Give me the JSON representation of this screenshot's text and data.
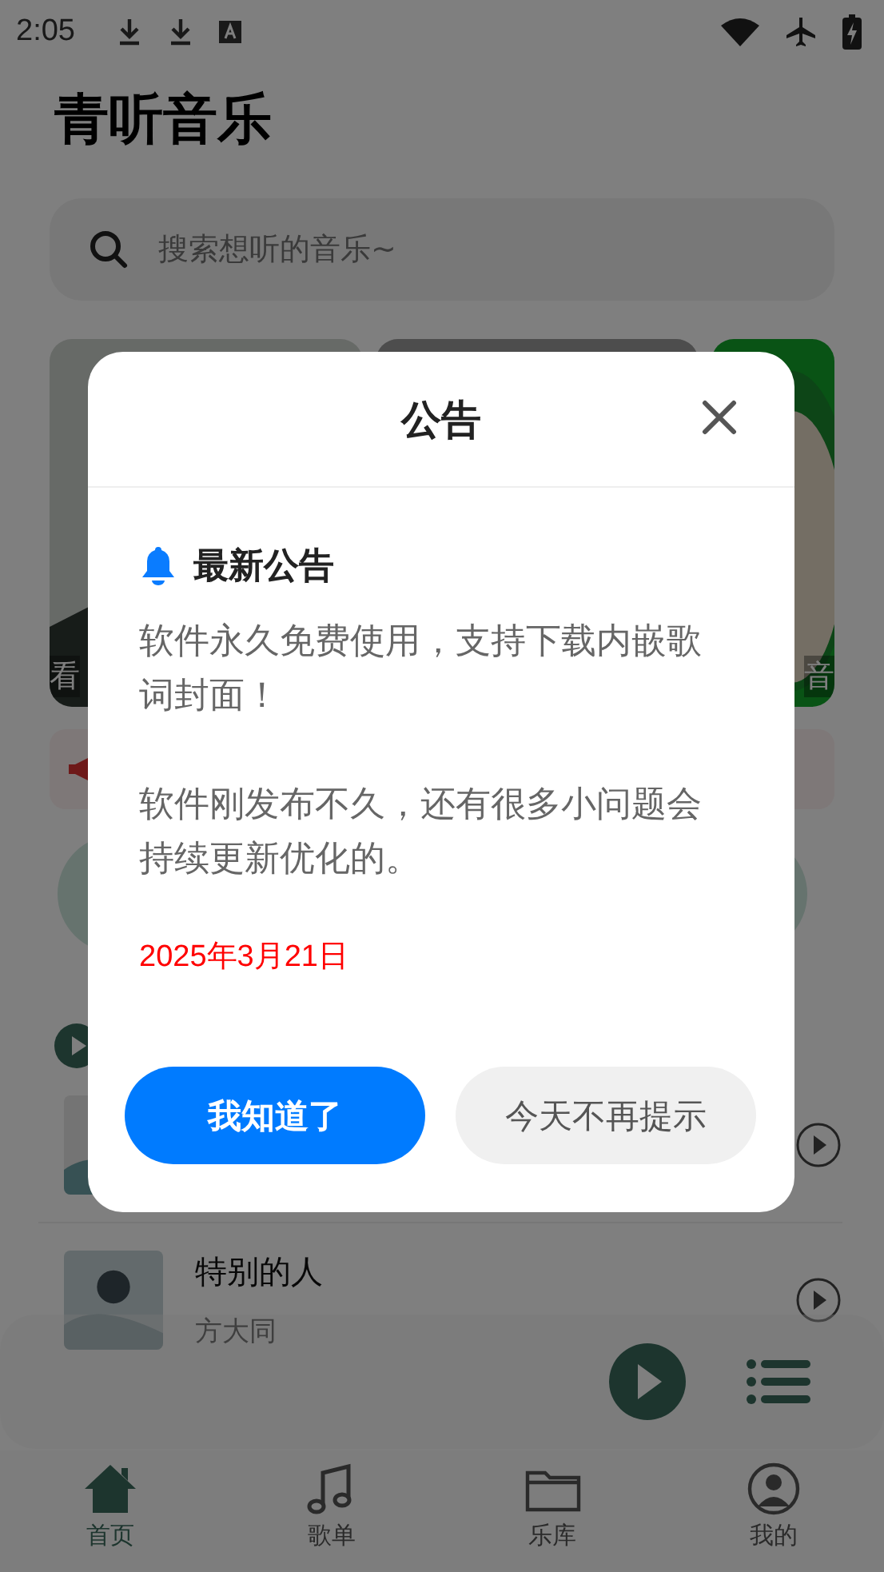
{
  "status_bar": {
    "time": "2:05"
  },
  "app": {
    "title": "青听音乐",
    "search": {
      "placeholder": "搜索想听的音乐~"
    },
    "banners": [
      {
        "kind": "picture",
        "caption": "看"
      },
      {
        "kind": "picture"
      },
      {
        "kind": "picture",
        "caption": "音"
      }
    ],
    "songs": [
      {
        "kind": "picture"
      },
      {
        "kind": "picture",
        "title": "特别的人",
        "artist": "方大同"
      }
    ]
  },
  "bottom_nav": [
    {
      "label": "首页",
      "selected": true
    },
    {
      "label": "歌单",
      "selected": false
    },
    {
      "label": "乐库",
      "selected": false
    },
    {
      "label": "我的",
      "selected": false
    }
  ],
  "dialog": {
    "title": "公告",
    "heading": "最新公告",
    "paragraphs": [
      "软件永久免费使用，支持下载内嵌歌词封面！",
      "软件刚发布不久，还有很多小问题会持续更新优化的。"
    ],
    "date": "2025年3月21日",
    "buttons": [
      {
        "label": "我知道了",
        "kind": "primary"
      },
      {
        "label": "今天不再提示",
        "kind": "secondary"
      }
    ]
  }
}
